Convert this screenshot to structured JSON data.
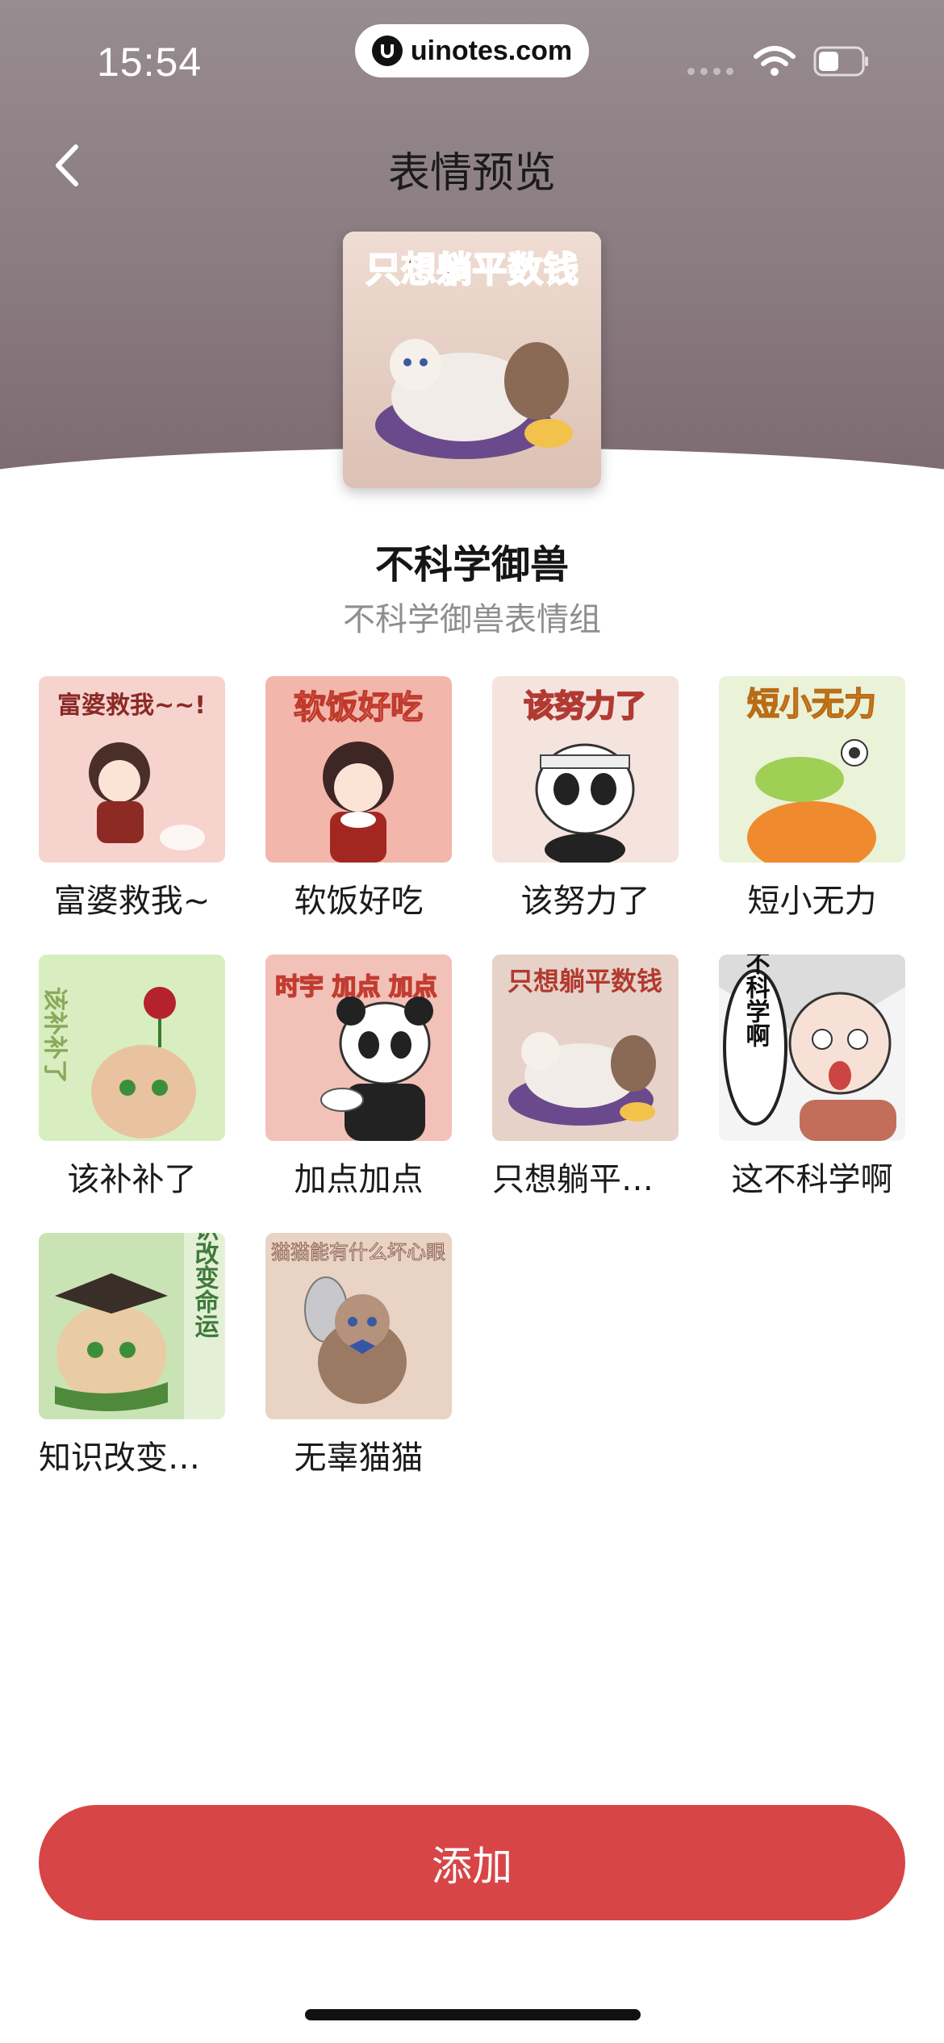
{
  "status_bar": {
    "time": "15:54",
    "url": "uinotes.com"
  },
  "nav": {
    "title": "表情预览",
    "back_icon": "chevron-left-icon"
  },
  "pack": {
    "cover_text": "只想躺平数钱",
    "name": "不科学御兽",
    "description": "不科学御兽表情组"
  },
  "stickers": [
    {
      "label": "富婆救我~",
      "art_text": "富婆救我~~!"
    },
    {
      "label": "软饭好吃",
      "art_text": "软饭好吃"
    },
    {
      "label": "该努力了",
      "art_text": "该努力了"
    },
    {
      "label": "短小无力",
      "art_text": "短小无力"
    },
    {
      "label": "该补补了",
      "art_text": "该补补了"
    },
    {
      "label": "加点加点",
      "art_text": "时宇 加点 加点"
    },
    {
      "label": "只想躺平数钱",
      "art_text": "只想躺平数钱"
    },
    {
      "label": "这不科学啊",
      "art_text": "这不科学啊"
    },
    {
      "label": "知识改变命运",
      "art_text": "知识改变命运"
    },
    {
      "label": "无辜猫猫",
      "art_text": "猫猫能有什么坏心眼"
    }
  ],
  "actions": {
    "add_label": "添加"
  },
  "colors": {
    "accent": "#d84546",
    "header": "#8a7c81"
  }
}
